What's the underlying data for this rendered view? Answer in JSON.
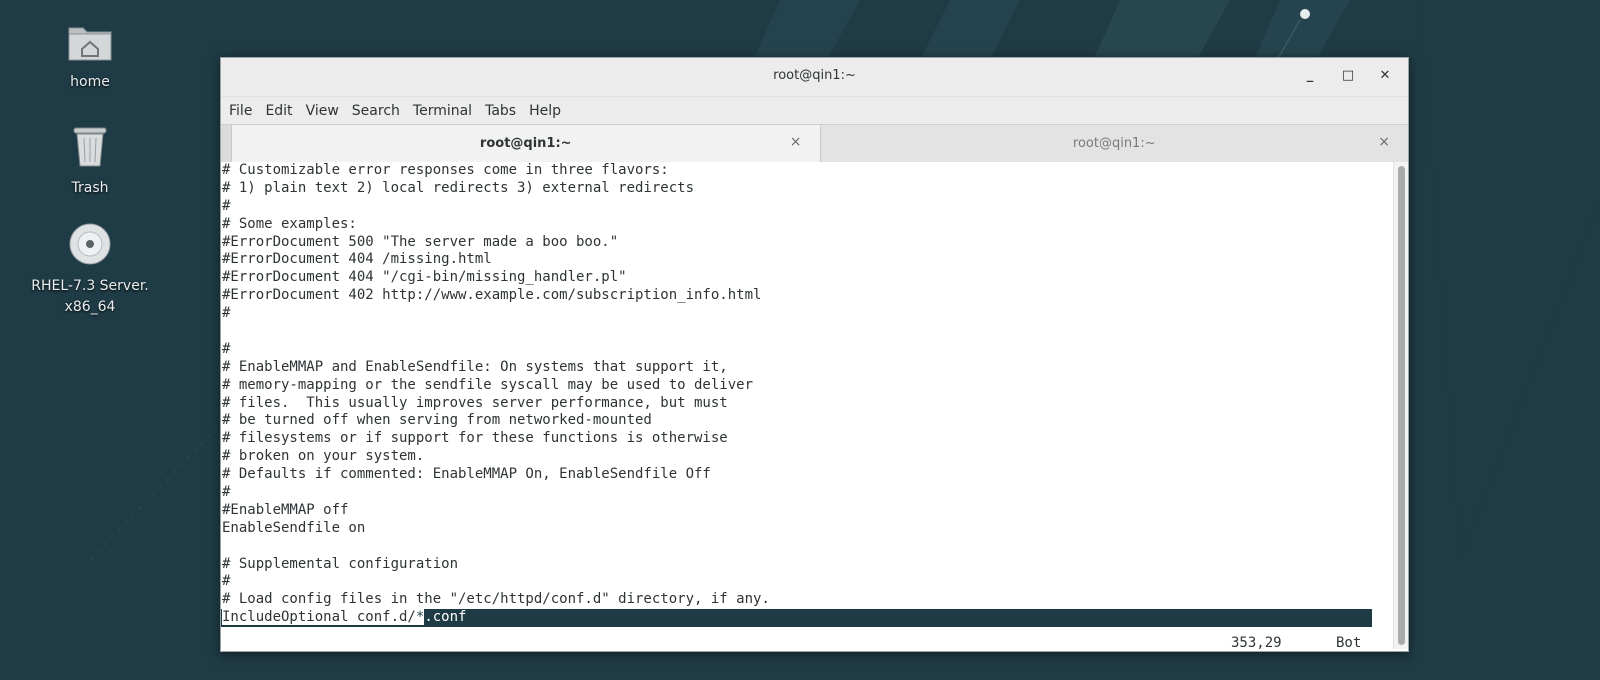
{
  "desktop": {
    "icons": [
      {
        "label_line1": "home",
        "label_line2": ""
      },
      {
        "label_line1": "Trash",
        "label_line2": ""
      },
      {
        "label_line1": "RHEL-7.3 Server.",
        "label_line2": "x86_64"
      }
    ]
  },
  "window": {
    "title": "root@qin1:~",
    "controls": {
      "minimize": "_",
      "maximize": "□",
      "close": "✕"
    },
    "menu": [
      "File",
      "Edit",
      "View",
      "Search",
      "Terminal",
      "Tabs",
      "Help"
    ],
    "tabs": [
      {
        "label": "root@qin1:~",
        "close": "×",
        "active": true
      },
      {
        "label": "root@qin1:~",
        "close": "×",
        "active": false
      }
    ]
  },
  "terminal": {
    "lines": [
      "# Customizable error responses come in three flavors:",
      "# 1) plain text 2) local redirects 3) external redirects",
      "#",
      "# Some examples:",
      "#ErrorDocument 500 \"The server made a boo boo.\"",
      "#ErrorDocument 404 /missing.html",
      "#ErrorDocument 404 \"/cgi-bin/missing_handler.pl\"",
      "#ErrorDocument 402 http://www.example.com/subscription_info.html",
      "#",
      "",
      "#",
      "# EnableMMAP and EnableSendfile: On systems that support it,",
      "# memory-mapping or the sendfile syscall may be used to deliver",
      "# files.  This usually improves server performance, but must",
      "# be turned off when serving from networked-mounted",
      "# filesystems or if support for these functions is otherwise",
      "# broken on your system.",
      "# Defaults if commented: EnableMMAP On, EnableSendfile Off",
      "#",
      "#EnableMMAP off",
      "EnableSendfile on",
      "",
      "# Supplemental configuration",
      "#",
      "# Load config files in the \"/etc/httpd/conf.d\" directory, if any."
    ],
    "last_line": {
      "before": "IncludeOptional conf.d/",
      "cursor": "*",
      "after": ".conf"
    },
    "status": {
      "position": "353,29",
      "percent": "Bot"
    }
  }
}
